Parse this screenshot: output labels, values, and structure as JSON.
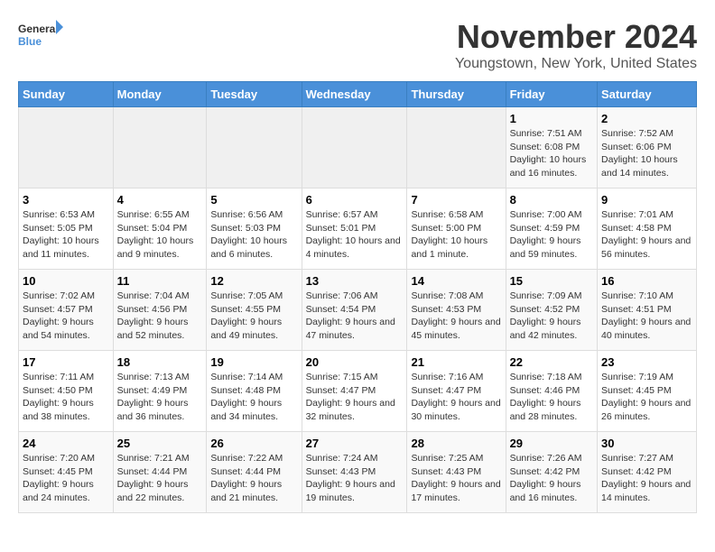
{
  "logo": {
    "general": "General",
    "blue": "Blue"
  },
  "title": "November 2024",
  "subtitle": "Youngstown, New York, United States",
  "days_of_week": [
    "Sunday",
    "Monday",
    "Tuesday",
    "Wednesday",
    "Thursday",
    "Friday",
    "Saturday"
  ],
  "weeks": [
    [
      {
        "day": "",
        "info": ""
      },
      {
        "day": "",
        "info": ""
      },
      {
        "day": "",
        "info": ""
      },
      {
        "day": "",
        "info": ""
      },
      {
        "day": "",
        "info": ""
      },
      {
        "day": "1",
        "info": "Sunrise: 7:51 AM\nSunset: 6:08 PM\nDaylight: 10 hours and 16 minutes."
      },
      {
        "day": "2",
        "info": "Sunrise: 7:52 AM\nSunset: 6:06 PM\nDaylight: 10 hours and 14 minutes."
      }
    ],
    [
      {
        "day": "3",
        "info": "Sunrise: 6:53 AM\nSunset: 5:05 PM\nDaylight: 10 hours and 11 minutes."
      },
      {
        "day": "4",
        "info": "Sunrise: 6:55 AM\nSunset: 5:04 PM\nDaylight: 10 hours and 9 minutes."
      },
      {
        "day": "5",
        "info": "Sunrise: 6:56 AM\nSunset: 5:03 PM\nDaylight: 10 hours and 6 minutes."
      },
      {
        "day": "6",
        "info": "Sunrise: 6:57 AM\nSunset: 5:01 PM\nDaylight: 10 hours and 4 minutes."
      },
      {
        "day": "7",
        "info": "Sunrise: 6:58 AM\nSunset: 5:00 PM\nDaylight: 10 hours and 1 minute."
      },
      {
        "day": "8",
        "info": "Sunrise: 7:00 AM\nSunset: 4:59 PM\nDaylight: 9 hours and 59 minutes."
      },
      {
        "day": "9",
        "info": "Sunrise: 7:01 AM\nSunset: 4:58 PM\nDaylight: 9 hours and 56 minutes."
      }
    ],
    [
      {
        "day": "10",
        "info": "Sunrise: 7:02 AM\nSunset: 4:57 PM\nDaylight: 9 hours and 54 minutes."
      },
      {
        "day": "11",
        "info": "Sunrise: 7:04 AM\nSunset: 4:56 PM\nDaylight: 9 hours and 52 minutes."
      },
      {
        "day": "12",
        "info": "Sunrise: 7:05 AM\nSunset: 4:55 PM\nDaylight: 9 hours and 49 minutes."
      },
      {
        "day": "13",
        "info": "Sunrise: 7:06 AM\nSunset: 4:54 PM\nDaylight: 9 hours and 47 minutes."
      },
      {
        "day": "14",
        "info": "Sunrise: 7:08 AM\nSunset: 4:53 PM\nDaylight: 9 hours and 45 minutes."
      },
      {
        "day": "15",
        "info": "Sunrise: 7:09 AM\nSunset: 4:52 PM\nDaylight: 9 hours and 42 minutes."
      },
      {
        "day": "16",
        "info": "Sunrise: 7:10 AM\nSunset: 4:51 PM\nDaylight: 9 hours and 40 minutes."
      }
    ],
    [
      {
        "day": "17",
        "info": "Sunrise: 7:11 AM\nSunset: 4:50 PM\nDaylight: 9 hours and 38 minutes."
      },
      {
        "day": "18",
        "info": "Sunrise: 7:13 AM\nSunset: 4:49 PM\nDaylight: 9 hours and 36 minutes."
      },
      {
        "day": "19",
        "info": "Sunrise: 7:14 AM\nSunset: 4:48 PM\nDaylight: 9 hours and 34 minutes."
      },
      {
        "day": "20",
        "info": "Sunrise: 7:15 AM\nSunset: 4:47 PM\nDaylight: 9 hours and 32 minutes."
      },
      {
        "day": "21",
        "info": "Sunrise: 7:16 AM\nSunset: 4:47 PM\nDaylight: 9 hours and 30 minutes."
      },
      {
        "day": "22",
        "info": "Sunrise: 7:18 AM\nSunset: 4:46 PM\nDaylight: 9 hours and 28 minutes."
      },
      {
        "day": "23",
        "info": "Sunrise: 7:19 AM\nSunset: 4:45 PM\nDaylight: 9 hours and 26 minutes."
      }
    ],
    [
      {
        "day": "24",
        "info": "Sunrise: 7:20 AM\nSunset: 4:45 PM\nDaylight: 9 hours and 24 minutes."
      },
      {
        "day": "25",
        "info": "Sunrise: 7:21 AM\nSunset: 4:44 PM\nDaylight: 9 hours and 22 minutes."
      },
      {
        "day": "26",
        "info": "Sunrise: 7:22 AM\nSunset: 4:44 PM\nDaylight: 9 hours and 21 minutes."
      },
      {
        "day": "27",
        "info": "Sunrise: 7:24 AM\nSunset: 4:43 PM\nDaylight: 9 hours and 19 minutes."
      },
      {
        "day": "28",
        "info": "Sunrise: 7:25 AM\nSunset: 4:43 PM\nDaylight: 9 hours and 17 minutes."
      },
      {
        "day": "29",
        "info": "Sunrise: 7:26 AM\nSunset: 4:42 PM\nDaylight: 9 hours and 16 minutes."
      },
      {
        "day": "30",
        "info": "Sunrise: 7:27 AM\nSunset: 4:42 PM\nDaylight: 9 hours and 14 minutes."
      }
    ]
  ]
}
